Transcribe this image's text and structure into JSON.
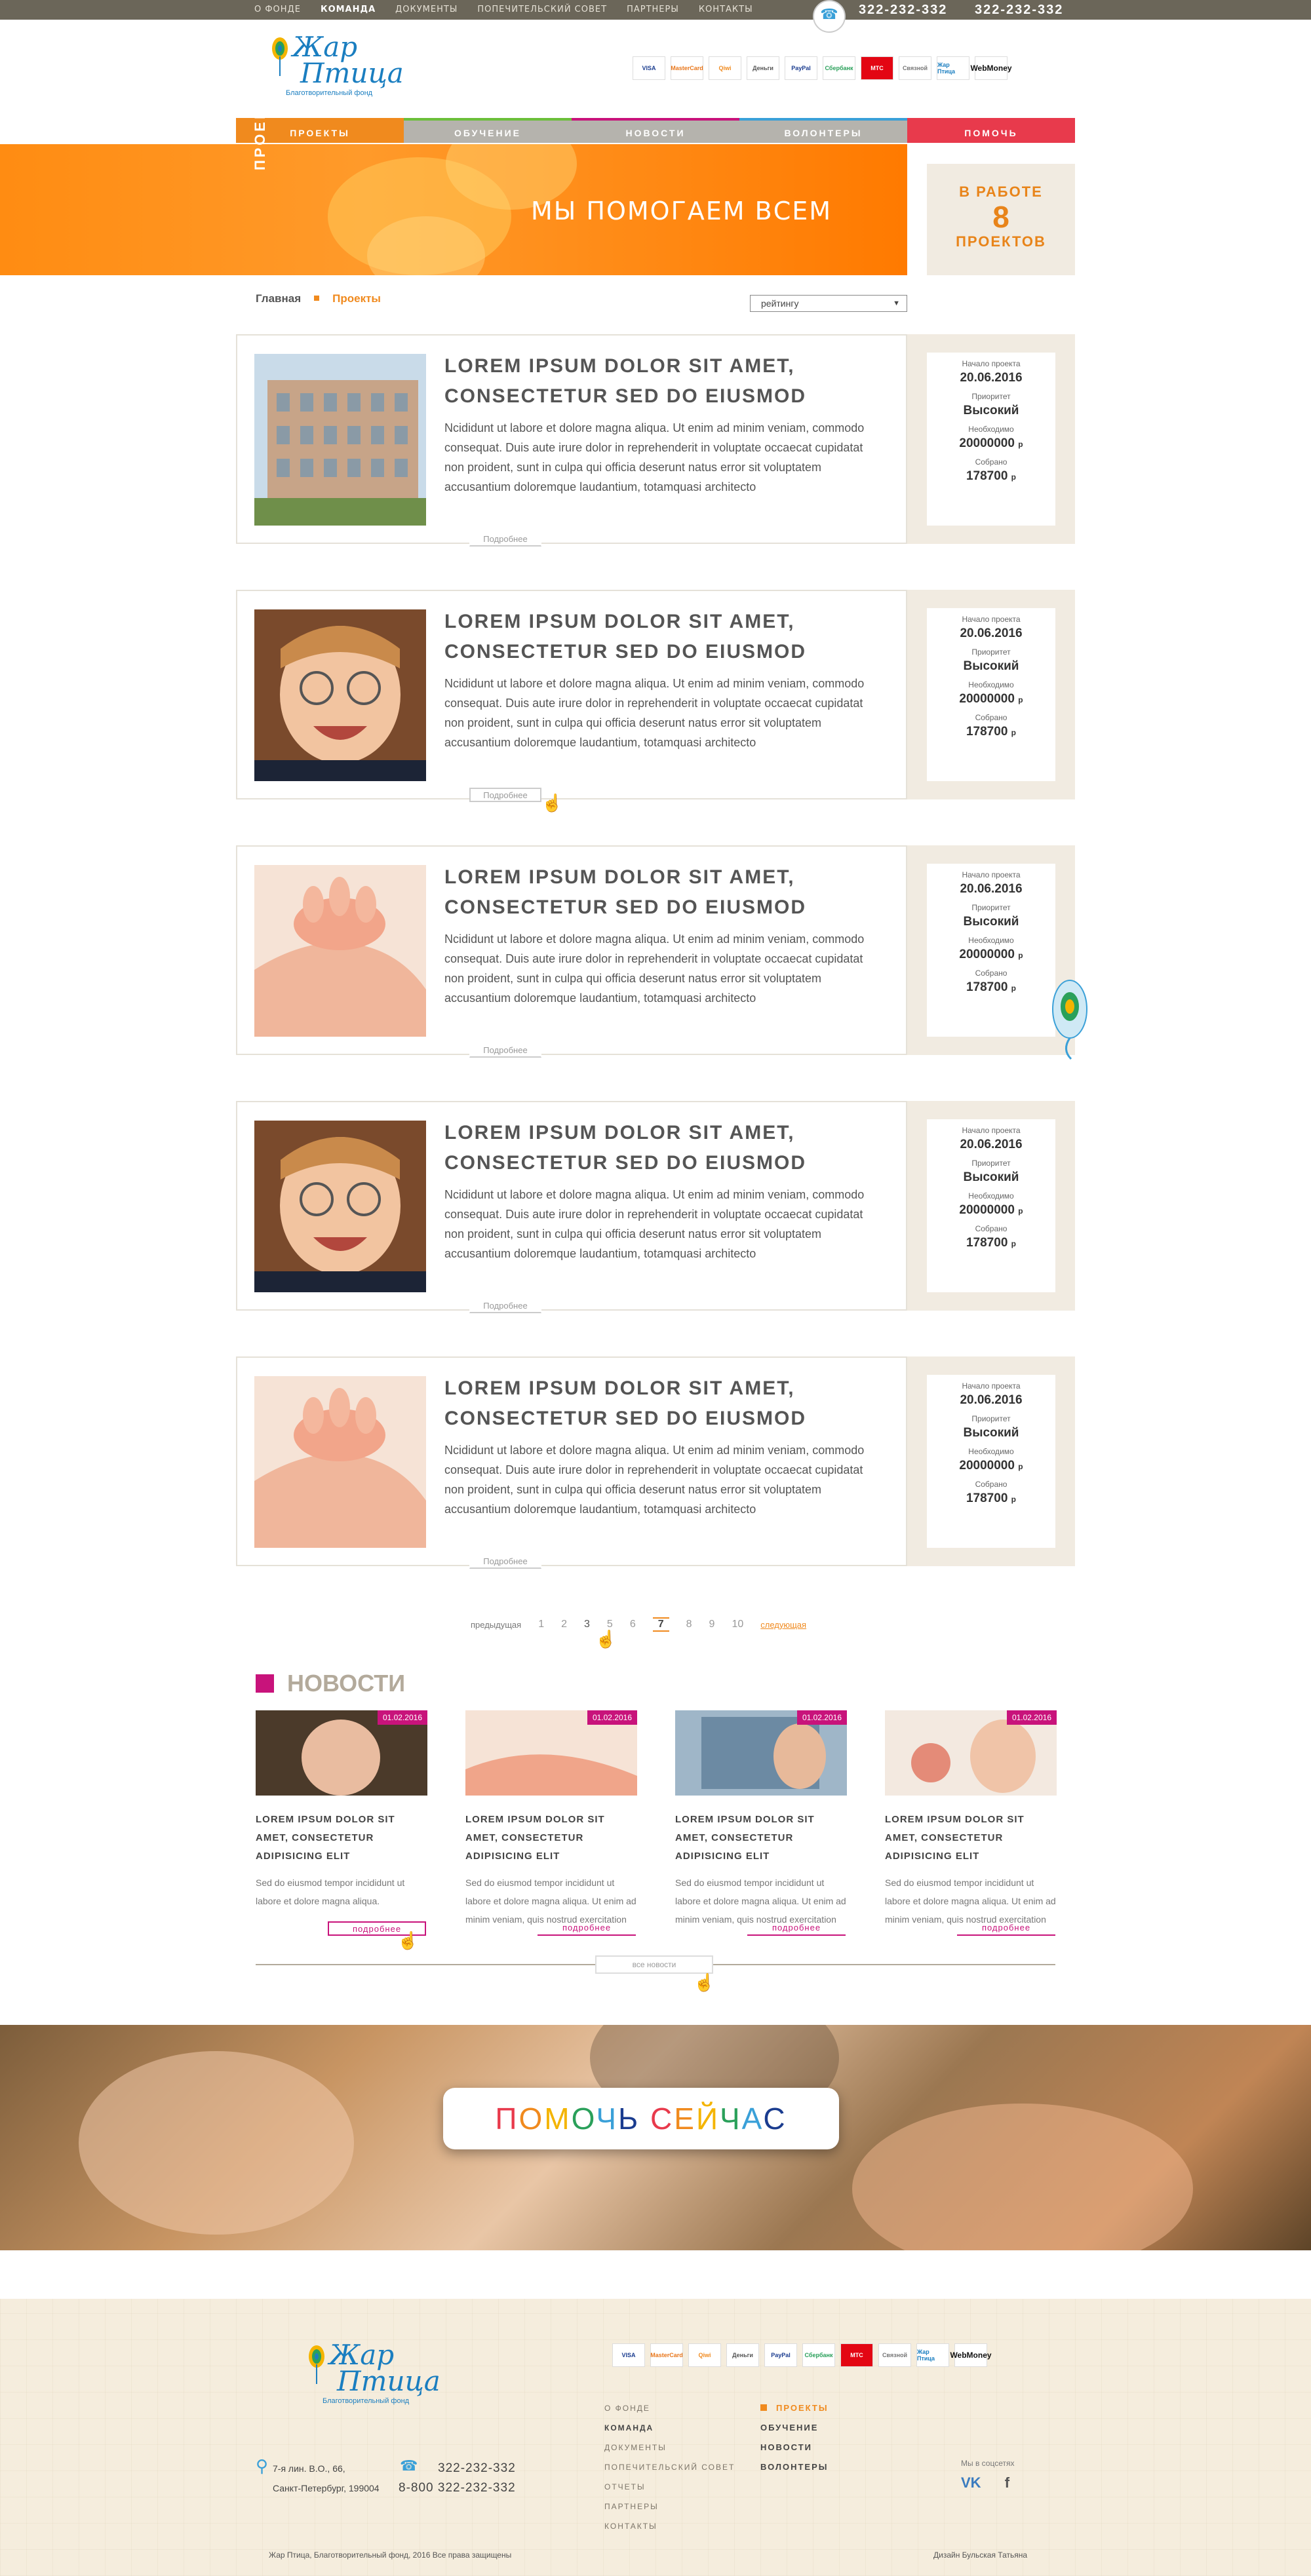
{
  "topbar": {
    "nav": [
      "О ФОНДЕ",
      "КОМАНДА",
      "ДОКУМЕНТЫ",
      "ПОПЕЧИТЕЛЬСКИЙ СОВЕТ",
      "ПАРТНЕРЫ",
      "КОНТАКТЫ"
    ],
    "phone1": "322-232-332",
    "phone2": "322-232-332"
  },
  "logo": {
    "line1": "Жар",
    "line2": "Птица",
    "sub": "Благотворительный фонд"
  },
  "payments": [
    "VISA",
    "MasterCard",
    "Qiwi",
    "Деньги",
    "PayPal",
    "Сбербанк",
    "МТС",
    "Связной",
    "Жар Птица",
    "WebMoney"
  ],
  "mainnav": [
    {
      "label": "ПРОЕКТЫ",
      "color": "#f08a1e"
    },
    {
      "label": "ОБУЧЕНИЕ",
      "color": "#a8a8a8"
    },
    {
      "label": "НОВОСТИ",
      "color": "#a8a8a8"
    },
    {
      "label": "ВОЛОНТЕРЫ",
      "color": "#a8a8a8"
    },
    {
      "label": "ПОМОЧЬ",
      "color": "#e83a4c"
    }
  ],
  "banner": {
    "side": "ПРОЕКТЫ",
    "title": "МЫ ПОМОГАЕМ ВСЕМ"
  },
  "work": {
    "line1": "В РАБОТЕ",
    "count": "8",
    "line2": "ПРОЕКТОВ"
  },
  "breadcrumb": {
    "home": "Главная",
    "current": "Проекты"
  },
  "sort": {
    "value": "рейтингу"
  },
  "projects": [
    {
      "title": "LOREM IPSUM DOLOR SIT AMET, CONSECTETUR SED DO EIUSMOD",
      "text": "Ncididunt ut labore et dolore magna aliqua. Ut enim ad minim veniam, commodo consequat. Duis aute irure dolor in reprehenderit in voluptate occaecat cupidatat non proident, sunt in culpa qui officia deserunt natus error sit voluptatem accusantium doloremque laudantium, totamquasi architecto",
      "more": "Подробнее",
      "start_label": "Начало проекта",
      "start": "20.06.2016",
      "priority_label": "Приоритет",
      "priority": "Высокий",
      "need_label": "Необходимо",
      "need": "20000000",
      "collected_label": "Собрано",
      "collected": "178700",
      "currency": "р"
    },
    {
      "title": "LOREM IPSUM DOLOR SIT AMET, CONSECTETUR SED DO EIUSMOD",
      "text": "Ncididunt ut labore et dolore magna aliqua. Ut enim ad minim veniam, commodo consequat. Duis aute irure dolor in reprehenderit in voluptate occaecat cupidatat non proident, sunt in culpa qui officia deserunt natus error sit voluptatem accusantium doloremque laudantium, totamquasi architecto",
      "more": "Подробнее",
      "start_label": "Начало проекта",
      "start": "20.06.2016",
      "priority_label": "Приоритет",
      "priority": "Высокий",
      "need_label": "Необходимо",
      "need": "20000000",
      "collected_label": "Собрано",
      "collected": "178700",
      "currency": "р"
    },
    {
      "title": "LOREM IPSUM DOLOR SIT AMET, CONSECTETUR SED DO EIUSMOD",
      "text": "Ncididunt ut labore et dolore magna aliqua. Ut enim ad minim veniam, commodo consequat. Duis aute irure dolor in reprehenderit in voluptate occaecat cupidatat non proident, sunt in culpa qui officia deserunt natus error sit voluptatem accusantium doloremque laudantium, totamquasi architecto",
      "more": "Подробнее",
      "start_label": "Начало проекта",
      "start": "20.06.2016",
      "priority_label": "Приоритет",
      "priority": "Высокий",
      "need_label": "Необходимо",
      "need": "20000000",
      "collected_label": "Собрано",
      "collected": "178700",
      "currency": "р"
    },
    {
      "title": "LOREM IPSUM DOLOR SIT AMET, CONSECTETUR SED DO EIUSMOD",
      "text": "Ncididunt ut labore et dolore magna aliqua. Ut enim ad minim veniam, commodo consequat. Duis aute irure dolor in reprehenderit in voluptate occaecat cupidatat non proident, sunt in culpa qui officia deserunt natus error sit voluptatem accusantium doloremque laudantium, totamquasi architecto",
      "more": "Подробнее",
      "start_label": "Начало проекта",
      "start": "20.06.2016",
      "priority_label": "Приоритет",
      "priority": "Высокий",
      "need_label": "Необходимо",
      "need": "20000000",
      "collected_label": "Собрано",
      "collected": "178700",
      "currency": "р"
    },
    {
      "title": "LOREM IPSUM DOLOR SIT AMET, CONSECTETUR SED DO EIUSMOD",
      "text": "Ncididunt ut labore et dolore magna aliqua. Ut enim ad minim veniam, commodo consequat. Duis aute irure dolor in reprehenderit in voluptate occaecat cupidatat non proident, sunt in culpa qui officia deserunt natus error sit voluptatem accusantium doloremque laudantium, totamquasi architecto",
      "more": "Подробнее",
      "start_label": "Начало проекта",
      "start": "20.06.2016",
      "priority_label": "Приоритет",
      "priority": "Высокий",
      "need_label": "Необходимо",
      "need": "20000000",
      "collected_label": "Собрано",
      "collected": "178700",
      "currency": "р"
    }
  ],
  "pager": {
    "prev": "предыдущая",
    "pages": [
      "1",
      "2",
      "3",
      "5",
      "6",
      "7",
      "8",
      "9",
      "10"
    ],
    "current": "7",
    "next": "следующая"
  },
  "news": {
    "heading": "НОВОСТИ",
    "items": [
      {
        "date": "01.02.2016",
        "title": "LOREM IPSUM DOLOR SIT AMET, CONSECTETUR ADIPISICING ELIT",
        "text": "Sed do eiusmod tempor incididunt ut labore et dolore magna aliqua.",
        "more": "подробнее"
      },
      {
        "date": "01.02.2016",
        "title": "LOREM IPSUM DOLOR SIT AMET, CONSECTETUR ADIPISICING ELIT",
        "text": "Sed do eiusmod tempor incididunt ut labore et dolore magna aliqua. Ut enim ad minim veniam, quis nostrud exercitation",
        "more": "подробнее"
      },
      {
        "date": "01.02.2016",
        "title": "LOREM IPSUM DOLOR SIT AMET, CONSECTETUR ADIPISICING ELIT",
        "text": "Sed do eiusmod tempor incididunt ut labore et dolore magna aliqua. Ut enim ad minim veniam, quis nostrud exercitation",
        "more": "подробнее"
      },
      {
        "date": "01.02.2016",
        "title": "LOREM IPSUM DOLOR SIT AMET, CONSECTETUR ADIPISICING ELIT",
        "text": "Sed do eiusmod tempor incididunt ut labore et dolore magna aliqua. Ut enim ad minim veniam, quis nostrud exercitation",
        "more": "подробнее"
      }
    ],
    "all": "все новости"
  },
  "help": {
    "label": "ПОМОЧЬ СЕЙЧАС"
  },
  "footer": {
    "nav1": [
      "О ФОНДЕ",
      "КОМАНДА",
      "ДОКУМЕНТЫ",
      "ПОПЕЧИТЕЛЬСКИЙ СОВЕТ",
      "ОТЧЕТЫ",
      "ПАРТНЕРЫ",
      "КОНТАКТЫ"
    ],
    "nav2": [
      "ПРОЕКТЫ",
      "ОБУЧЕНИЕ",
      "НОВОСТИ",
      "ВОЛОНТЕРЫ"
    ],
    "addr1": "7-я лин. В.О., 66,",
    "addr2": "Санкт-Петербург, 199004",
    "phone1": "322-232-332",
    "phone2": "8-800 322-232-332",
    "social_label": "Мы в соцсетях",
    "copyright": "Жар Птица, Благотворительный фонд, 2016 Все права защищены",
    "design": "Дизайн Бульская Татьяна"
  },
  "colors": {
    "accent": "#f08a1e",
    "magenta": "#c8137b",
    "help_red": "#e83a4c"
  }
}
